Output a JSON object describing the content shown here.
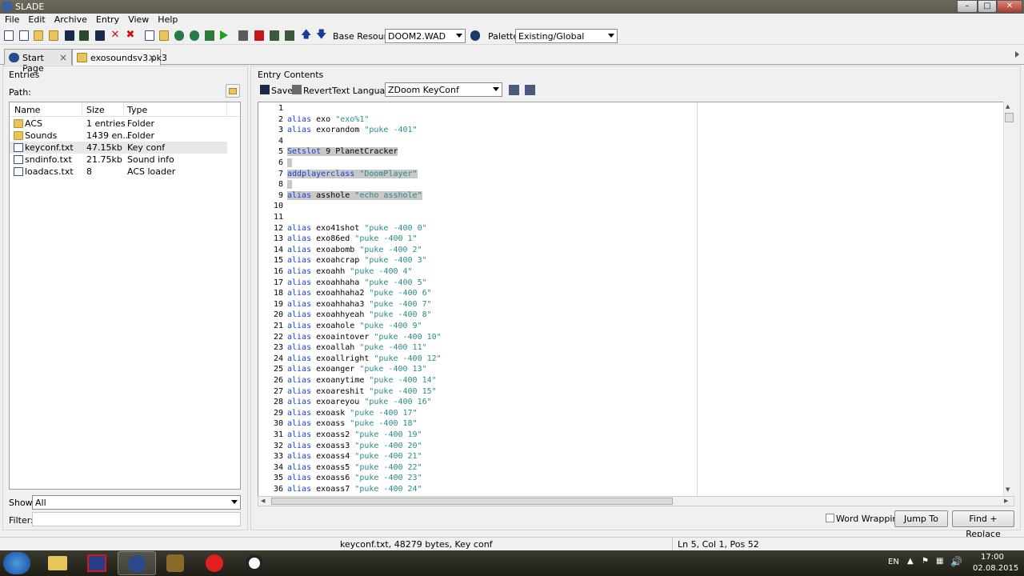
{
  "window": {
    "title": "SLADE",
    "min_label": "–",
    "max_label": "□",
    "close_label": "✕"
  },
  "menu": [
    "File",
    "Edit",
    "Archive",
    "Entry",
    "View",
    "Help"
  ],
  "toolbar": {
    "base_resource_label": "Base Resource:",
    "base_resource_value": "DOOM2.WAD",
    "palette_label": "Palette:",
    "palette_value": "Existing/Global"
  },
  "tabs": [
    {
      "label": "Start Page",
      "close": "×"
    },
    {
      "label": "exosoundsv3.pk3",
      "close": "×"
    }
  ],
  "entries": {
    "title": "Entries",
    "path_label": "Path:",
    "columns": [
      "Name",
      "Size",
      "Type"
    ],
    "rows": [
      {
        "name": "ACS",
        "size": "1 entries",
        "type": "Folder",
        "icon": "folder-icon"
      },
      {
        "name": "Sounds",
        "size": "1439 en...",
        "type": "Folder",
        "icon": "folder-icon"
      },
      {
        "name": "keyconf.txt",
        "size": "47.15kb",
        "type": "Key conf",
        "icon": "text-file-icon"
      },
      {
        "name": "sndinfo.txt",
        "size": "21.75kb",
        "type": "Sound info",
        "icon": "text-file-icon"
      },
      {
        "name": "loadacs.txt",
        "size": "8",
        "type": "ACS loader",
        "icon": "text-file-icon"
      }
    ],
    "show_label": "Show:",
    "show_value": "All",
    "filter_label": "Filter:",
    "filter_value": ""
  },
  "entry_contents": {
    "title": "Entry Contents",
    "save_label": "Save",
    "revert_label": "Revert",
    "text_language_label": "Text Language:",
    "text_language_value": "ZDoom KeyConf"
  },
  "code": {
    "highlighted_lines": [
      5,
      6,
      7,
      8,
      9
    ],
    "lines": [
      [],
      [
        {
          "t": "alias",
          "c": "kw"
        },
        {
          "t": " exo "
        },
        {
          "t": "\"exo%1\"",
          "c": "str"
        }
      ],
      [
        {
          "t": "alias",
          "c": "kw"
        },
        {
          "t": " exorandom "
        },
        {
          "t": "\"puke -401\"",
          "c": "str"
        }
      ],
      [],
      [
        {
          "t": "Setslot",
          "c": "kw"
        },
        {
          "t": " 9 PlanetCracker"
        }
      ],
      [],
      [
        {
          "t": "addplayerclass",
          "c": "kw"
        },
        {
          "t": " "
        },
        {
          "t": "\"DoomPlayer\"",
          "c": "str"
        }
      ],
      [],
      [
        {
          "t": "alias",
          "c": "kw"
        },
        {
          "t": " asshole "
        },
        {
          "t": "\"echo asshole\"",
          "c": "str"
        }
      ],
      [],
      [],
      [
        {
          "t": "alias",
          "c": "kw"
        },
        {
          "t": " exo41shot "
        },
        {
          "t": "\"puke -400 0\"",
          "c": "str"
        }
      ],
      [
        {
          "t": "alias",
          "c": "kw"
        },
        {
          "t": " exo86ed "
        },
        {
          "t": "\"puke -400 1\"",
          "c": "str"
        }
      ],
      [
        {
          "t": "alias",
          "c": "kw"
        },
        {
          "t": " exoabomb "
        },
        {
          "t": "\"puke -400 2\"",
          "c": "str"
        }
      ],
      [
        {
          "t": "alias",
          "c": "kw"
        },
        {
          "t": " exoahcrap "
        },
        {
          "t": "\"puke -400 3\"",
          "c": "str"
        }
      ],
      [
        {
          "t": "alias",
          "c": "kw"
        },
        {
          "t": " exoahh "
        },
        {
          "t": "\"puke -400 4\"",
          "c": "str"
        }
      ],
      [
        {
          "t": "alias",
          "c": "kw"
        },
        {
          "t": " exoahhaha "
        },
        {
          "t": "\"puke -400 5\"",
          "c": "str"
        }
      ],
      [
        {
          "t": "alias",
          "c": "kw"
        },
        {
          "t": " exoahhaha2 "
        },
        {
          "t": "\"puke -400 6\"",
          "c": "str"
        }
      ],
      [
        {
          "t": "alias",
          "c": "kw"
        },
        {
          "t": " exoahhaha3 "
        },
        {
          "t": "\"puke -400 7\"",
          "c": "str"
        }
      ],
      [
        {
          "t": "alias",
          "c": "kw"
        },
        {
          "t": " exoahhyeah "
        },
        {
          "t": "\"puke -400 8\"",
          "c": "str"
        }
      ],
      [
        {
          "t": "alias",
          "c": "kw"
        },
        {
          "t": " exoahole "
        },
        {
          "t": "\"puke -400 9\"",
          "c": "str"
        }
      ],
      [
        {
          "t": "alias",
          "c": "kw"
        },
        {
          "t": " exoaintover "
        },
        {
          "t": "\"puke -400 10\"",
          "c": "str"
        }
      ],
      [
        {
          "t": "alias",
          "c": "kw"
        },
        {
          "t": " exoallah "
        },
        {
          "t": "\"puke -400 11\"",
          "c": "str"
        }
      ],
      [
        {
          "t": "alias",
          "c": "kw"
        },
        {
          "t": " exoallright "
        },
        {
          "t": "\"puke -400 12\"",
          "c": "str"
        }
      ],
      [
        {
          "t": "alias",
          "c": "kw"
        },
        {
          "t": " exoanger "
        },
        {
          "t": "\"puke -400 13\"",
          "c": "str"
        }
      ],
      [
        {
          "t": "alias",
          "c": "kw"
        },
        {
          "t": " exoanytime "
        },
        {
          "t": "\"puke -400 14\"",
          "c": "str"
        }
      ],
      [
        {
          "t": "alias",
          "c": "kw"
        },
        {
          "t": " exoareshit "
        },
        {
          "t": "\"puke -400 15\"",
          "c": "str"
        }
      ],
      [
        {
          "t": "alias",
          "c": "kw"
        },
        {
          "t": " exoareyou "
        },
        {
          "t": "\"puke -400 16\"",
          "c": "str"
        }
      ],
      [
        {
          "t": "alias",
          "c": "kw"
        },
        {
          "t": " exoask "
        },
        {
          "t": "\"puke -400 17\"",
          "c": "str"
        }
      ],
      [
        {
          "t": "alias",
          "c": "kw"
        },
        {
          "t": " exoass "
        },
        {
          "t": "\"puke -400 18\"",
          "c": "str"
        }
      ],
      [
        {
          "t": "alias",
          "c": "kw"
        },
        {
          "t": " exoass2 "
        },
        {
          "t": "\"puke -400 19\"",
          "c": "str"
        }
      ],
      [
        {
          "t": "alias",
          "c": "kw"
        },
        {
          "t": " exoass3 "
        },
        {
          "t": "\"puke -400 20\"",
          "c": "str"
        }
      ],
      [
        {
          "t": "alias",
          "c": "kw"
        },
        {
          "t": " exoass4 "
        },
        {
          "t": "\"puke -400 21\"",
          "c": "str"
        }
      ],
      [
        {
          "t": "alias",
          "c": "kw"
        },
        {
          "t": " exoass5 "
        },
        {
          "t": "\"puke -400 22\"",
          "c": "str"
        }
      ],
      [
        {
          "t": "alias",
          "c": "kw"
        },
        {
          "t": " exoass6 "
        },
        {
          "t": "\"puke -400 23\"",
          "c": "str"
        }
      ],
      [
        {
          "t": "alias",
          "c": "kw"
        },
        {
          "t": " exoass7 "
        },
        {
          "t": "\"puke -400 24\"",
          "c": "str"
        }
      ]
    ]
  },
  "bottom": {
    "word_wrapping_label": "Word Wrapping",
    "jump_to_label": "Jump To",
    "find_replace_label": "Find + Replace"
  },
  "status": {
    "left": "keyconf.txt, 48279 bytes, Key conf",
    "right": "Ln 5, Col 1, Pos 52"
  },
  "taskbar": {
    "lang": "EN",
    "time": "17:00",
    "date": "02.08.2015"
  }
}
